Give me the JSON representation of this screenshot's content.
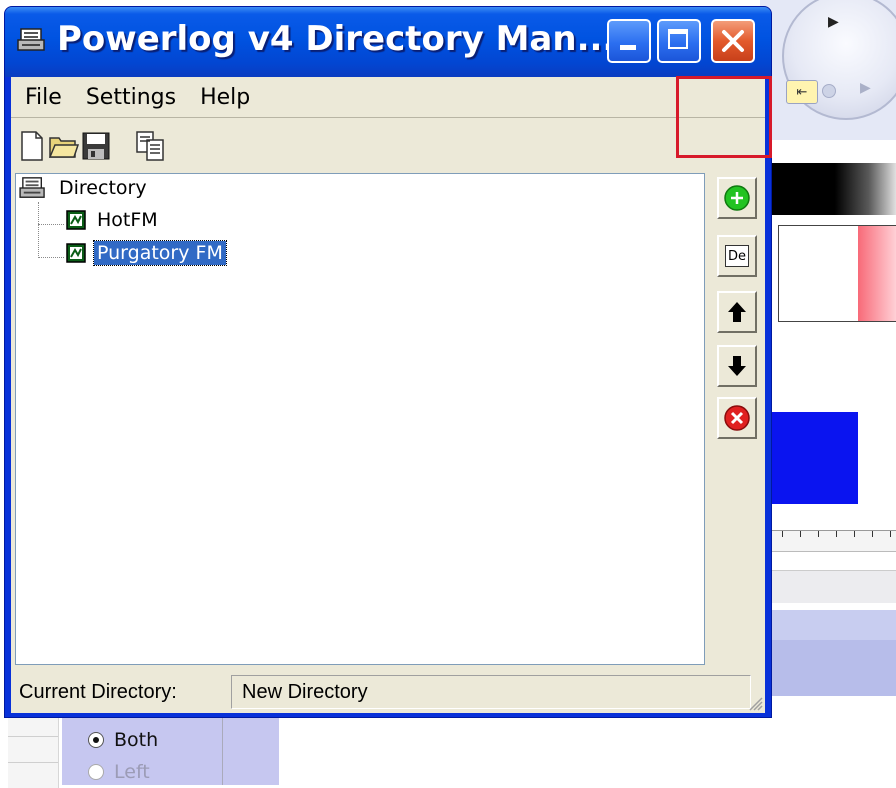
{
  "window": {
    "title": "Powerlog v4 Directory Man...",
    "icon": "directory-app-icon",
    "controls": [
      "minimize",
      "maximize",
      "close"
    ]
  },
  "menu": {
    "items": [
      "File",
      "Settings",
      "Help"
    ]
  },
  "toolbar": {
    "buttons": [
      "new-document-icon",
      "open-folder-icon",
      "save-disk-icon",
      "copy-documents-icon"
    ]
  },
  "tree": {
    "root": "Directory",
    "children": [
      {
        "label": "HotFM",
        "selected": false
      },
      {
        "label": "Purgatory FM",
        "selected": true
      }
    ]
  },
  "side_buttons": {
    "add": "add-entry-icon",
    "de_label": "De",
    "up": "move-up-icon",
    "down": "move-down-icon",
    "delete": "delete-entry-icon"
  },
  "status": {
    "label": "Current Directory:",
    "value": "New Directory"
  },
  "background_panel": {
    "radio_options": [
      {
        "label": "Both",
        "checked": true,
        "enabled": true
      },
      {
        "label": "Left",
        "checked": false,
        "enabled": false
      }
    ]
  },
  "colors": {
    "titlebar": "#0053e1",
    "selection": "#316ac5",
    "highlight_box": "#d7192a",
    "add_button": "#22c322",
    "delete_button": "#e02020"
  }
}
